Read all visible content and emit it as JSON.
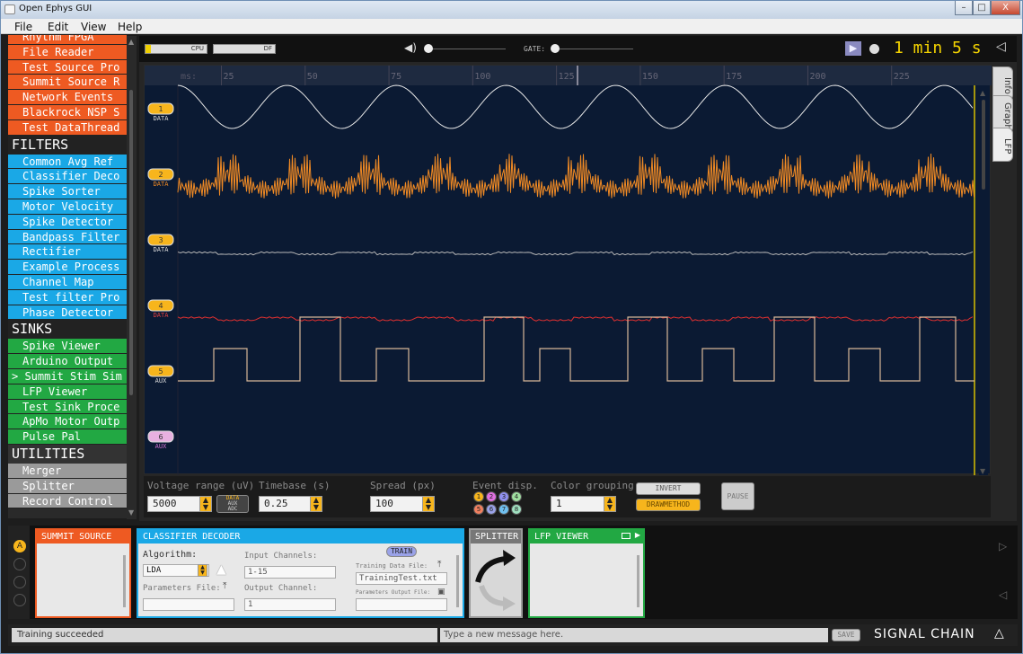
{
  "window": {
    "title": "Open Ephys GUI",
    "minimize": "–",
    "maximize": "□",
    "close": "X"
  },
  "menu": [
    "File",
    "Edit",
    "View",
    "Help"
  ],
  "sidebar": {
    "sources": [
      "Rhythm FPGA",
      "File Reader",
      "Test Source Pro",
      "Summit Source R",
      "Network Events",
      "Blackrock NSP S",
      "Test DataThread"
    ],
    "filters_header": "FILTERS",
    "filters": [
      "Common Avg Ref",
      "Classifier Deco",
      "Spike Sorter",
      "Motor Velocity",
      "Spike Detector",
      "Bandpass Filter",
      "Rectifier",
      "Example Process",
      "Channel Map",
      "Test filter Pro",
      "Phase Detector"
    ],
    "sinks_header": "SINKS",
    "sinks": [
      "Spike Viewer",
      "Arduino Output",
      "Summit Stim Sim",
      "LFP Viewer",
      "Test Sink Proce",
      "ApMo Motor Outp",
      "Pulse Pal"
    ],
    "sinks_selected_marker": ">",
    "utilities_header": "UTILITIES",
    "utilities": [
      "Merger",
      "Splitter",
      "Record Control"
    ]
  },
  "controlbar": {
    "cpu_label": "CPU",
    "df_label": "DF",
    "gate_label": "GATE:",
    "volume_icon": "speaker-icon",
    "timer": "1 min 5 s"
  },
  "tabs": [
    "Info",
    "Graph",
    "LFP"
  ],
  "timeline": {
    "unit_label": "ms:",
    "ticks": [
      "25",
      "50",
      "75",
      "100",
      "125",
      "150",
      "175",
      "200",
      "225"
    ],
    "tick_values": [
      25,
      50,
      75,
      100,
      125,
      150,
      175,
      200,
      225
    ],
    "start": 12,
    "end": 250
  },
  "channels": [
    {
      "num": "1",
      "type": "DATA",
      "color": "#e0e0e0",
      "badge": "#f7b51c"
    },
    {
      "num": "2",
      "type": "DATA",
      "color": "#f08a24",
      "badge": "#f7b51c"
    },
    {
      "num": "3",
      "type": "DATA",
      "color": "#c8c8c8",
      "badge": "#f7b51c"
    },
    {
      "num": "4",
      "type": "DATA",
      "color": "#e03030",
      "badge": "#f7b51c"
    },
    {
      "num": "5",
      "type": "AUX",
      "color": "#d8b898",
      "badge": "#f7b51c"
    },
    {
      "num": "6",
      "type": "AUX",
      "color": "#d070d0",
      "badge": "#e8b0e0"
    }
  ],
  "lfp_controls": {
    "voltage_label": "Voltage range (uV)",
    "voltage_value": "5000",
    "type_btn": [
      "DATA",
      "AUX",
      "ADC"
    ],
    "timebase_label": "Timebase (s)",
    "timebase_value": "0.25",
    "spread_label": "Spread (px)",
    "spread_value": "100",
    "event_label": "Event disp.",
    "events": [
      "1",
      "2",
      "3",
      "4",
      "5",
      "6",
      "7",
      "8"
    ],
    "color_label": "Color grouping",
    "color_value": "1",
    "invert": "INVERT",
    "drawmethod": "DRAWMETHOD",
    "pause": "PAUSE"
  },
  "editors": {
    "summit": {
      "title": "SUMMIT SOURCE"
    },
    "classifier": {
      "title": "CLASSIFIER DECODER",
      "algorithm_label": "Algorithm:",
      "algorithm_value": "LDA",
      "input_label": "Input Channels:",
      "input_value": "1-15",
      "params_file_label": "Parameters File:",
      "output_label": "Output Channel:",
      "output_value": "1",
      "train": "TRAIN",
      "training_label": "Training Data File:",
      "training_value": "TrainingTest.txt",
      "params_out_label": "Parameters Output File:"
    },
    "splitter": {
      "title": "SPLITTER"
    },
    "lfp": {
      "title": "LFP VIEWER"
    }
  },
  "signal_chain_slot": "A",
  "status": {
    "message": "Training succeeded",
    "input_placeholder": "Type a new message here.",
    "save": "SAVE",
    "signal_chain": "SIGNAL CHAIN"
  }
}
